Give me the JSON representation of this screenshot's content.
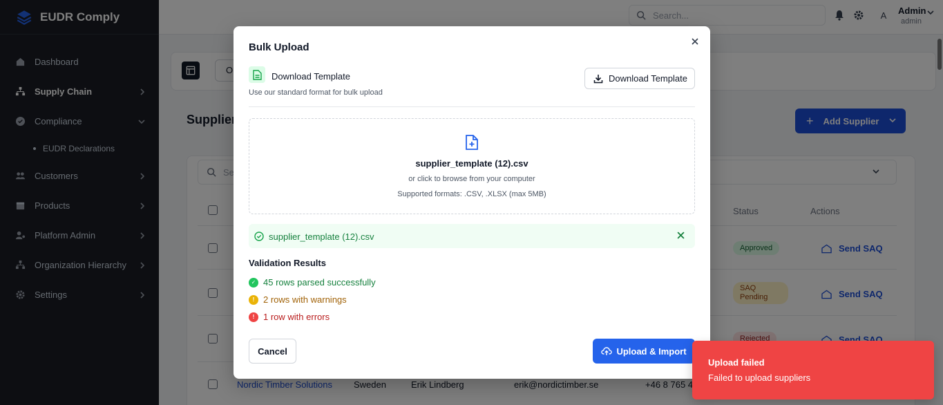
{
  "app": {
    "title": "EUDR Comply"
  },
  "sidebar": {
    "items": [
      {
        "label": "Dashboard",
        "icon": "home-icon"
      },
      {
        "label": "Supply Chain",
        "icon": "network-icon"
      },
      {
        "label": "Compliance",
        "icon": "check-circle-icon"
      },
      {
        "label": "EUDR Declarations"
      },
      {
        "label": "Customers",
        "icon": "users-icon"
      },
      {
        "label": "Products",
        "icon": "box-icon"
      },
      {
        "label": "Platform Admin",
        "icon": "admin-icon"
      },
      {
        "label": "Organization Hierarchy",
        "icon": "hierarchy-icon"
      },
      {
        "label": "Settings",
        "icon": "gear-icon"
      }
    ]
  },
  "topbar": {
    "search_placeholder": "Search...",
    "avatar_initial": "A",
    "user_name": "Admin",
    "user_role": "admin"
  },
  "page": {
    "tab_label": "O",
    "title": "Supplier",
    "add_button": "Add Supplier",
    "table_search": "Sea",
    "headers": {
      "status": "Status",
      "actions": "Actions"
    },
    "rows": [
      {
        "status": "Approved",
        "action": "Send SAQ"
      },
      {
        "status": "SAQ Pending",
        "action": "Send SAQ"
      },
      {
        "status": "Rejected",
        "action": "Send SAQ"
      },
      {
        "name": "Nordic Timber Solutions",
        "country": "Sweden",
        "contact": "Erik Lindberg",
        "email": "erik@nordictimber.se",
        "phone": "+46 8 765 4"
      }
    ]
  },
  "modal": {
    "title": "Bulk Upload",
    "template_title": "Download Template",
    "template_sub": "Use our standard format for bulk upload",
    "template_button": "Download Template",
    "dropzone": {
      "file_name": "supplier_template (12).csv",
      "hint": "or click to browse from your computer",
      "formats": "Supported formats: .CSV, .XLSX (max 5MB)"
    },
    "selected_file": "supplier_template (12).csv",
    "validation": {
      "title": "Validation Results",
      "ok": "45 rows parsed successfully",
      "warn": "2 rows with warnings",
      "err": "1 row with errors"
    },
    "cancel": "Cancel",
    "upload": "Upload & Import"
  },
  "toast": {
    "title": "Upload failed",
    "message": "Failed to upload suppliers"
  },
  "colors": {
    "primary": "#2563eb",
    "sidebar": "#1a1d24",
    "error": "#ef4444",
    "success": "#15803d"
  }
}
